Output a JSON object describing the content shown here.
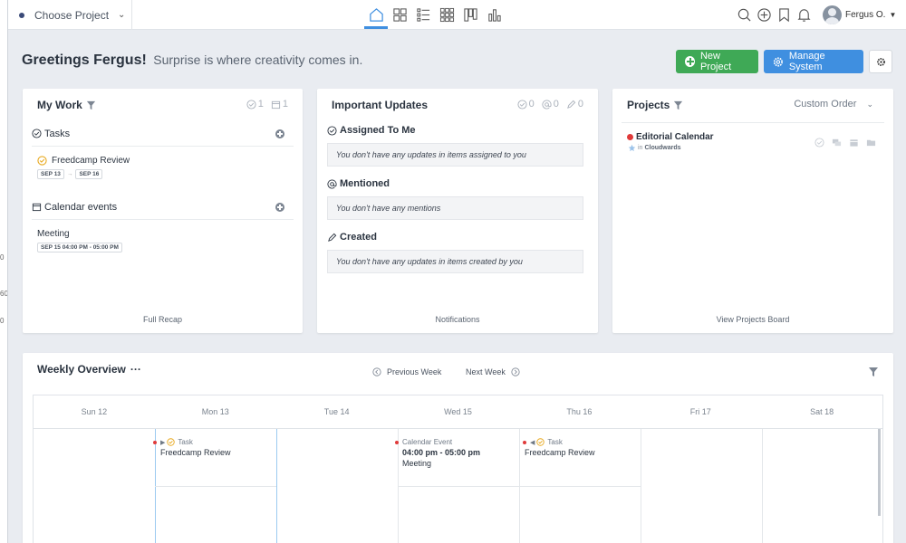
{
  "topbar": {
    "project_select": "Choose Project",
    "user_name": "Fergus O."
  },
  "greeting": {
    "title": "Greetings Fergus!",
    "subtitle": "Surprise is where creativity comes in."
  },
  "buttons": {
    "new_project": "New Project",
    "manage_system": "Manage System"
  },
  "my_work": {
    "title": "My Work",
    "count_tasks": "1",
    "count_events": "1",
    "tasks_label": "Tasks",
    "task_title": "Freedcamp Review",
    "task_start": "SEP 13",
    "task_end": "SEP 16",
    "events_label": "Calendar events",
    "event_title": "Meeting",
    "event_time": "SEP 15 04:00 PM - 05:00 PM",
    "footer": "Full Recap"
  },
  "updates": {
    "title": "Important Updates",
    "count_assigned": "0",
    "count_mentions": "0",
    "count_created": "0",
    "assigned_label": "Assigned To Me",
    "assigned_text": "You don't have any updates in items assigned to you",
    "mentioned_label": "Mentioned",
    "mentioned_text": "You don't have any mentions",
    "created_label": "Created",
    "created_text": "You don't have any updates in items created by you",
    "footer": "Notifications"
  },
  "projects": {
    "title": "Projects",
    "sort_label": "Custom Order",
    "project_name": "Editorial Calendar",
    "project_in": "in",
    "project_group": "Cloudwards",
    "footer": "View Projects Board"
  },
  "weekly": {
    "title": "Weekly Overview",
    "more": "···",
    "prev": "Previous Week",
    "next": "Next Week",
    "days": [
      "Sun 12",
      "Mon 13",
      "Tue 14",
      "Wed 15",
      "Thu 16",
      "Fri 17",
      "Sat 18"
    ],
    "mon_type": "Task",
    "mon_title": "Freedcamp Review",
    "wed_type": "Calendar Event",
    "wed_time": "04:00 pm - 05:00 pm",
    "wed_title": "Meeting",
    "thu_type": "Task",
    "thu_title": "Freedcamp Review"
  },
  "colors": {
    "accent_blue": "#3f8fe0",
    "accent_green": "#3fa956",
    "project_red": "#e03a3a"
  }
}
